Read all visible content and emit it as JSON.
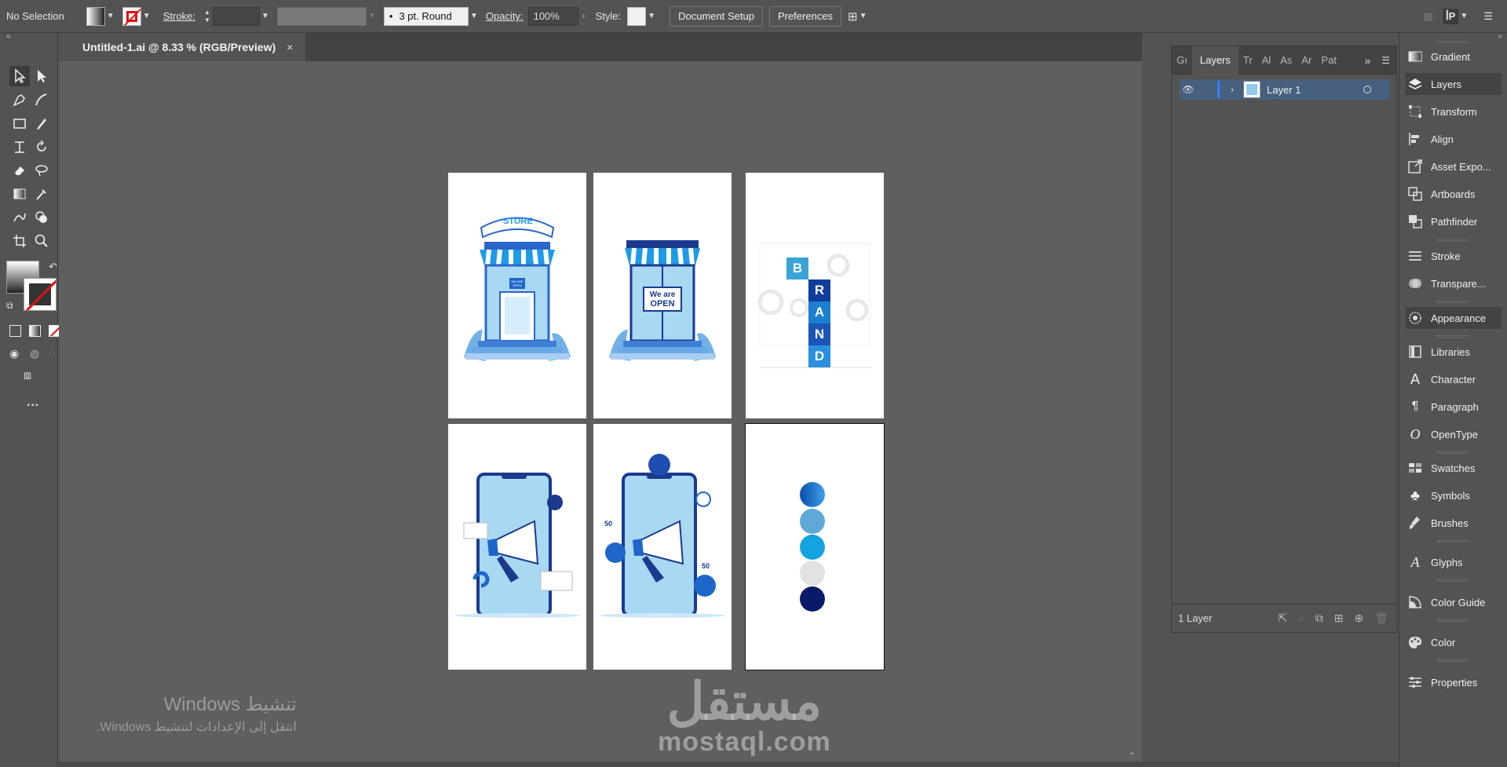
{
  "control_bar": {
    "selection": "No Selection",
    "stroke_label": "Stroke:",
    "stroke_weight": "",
    "brush": "3 pt. Round",
    "opacity_label": "Opacity:",
    "opacity_value": "100%",
    "style_label": "Style:",
    "document_setup": "Document Setup",
    "preferences": "Preferences"
  },
  "document": {
    "tab_title": "Untitled-1.ai @ 8.33 % (RGB/Preview)",
    "close": "×"
  },
  "artboards": {
    "store_sign": "STORE",
    "store_door_sign": "WE ARE OPEN",
    "open_sign_line1": "We are",
    "open_sign_line2": "OPEN",
    "brand_letters": [
      "B",
      "R",
      "A",
      "N",
      "D"
    ],
    "social_counts": [
      "50",
      "50"
    ],
    "palette": [
      "#0a4fa8",
      "#5fa8d8",
      "#12a3e0",
      "#e2e2e2",
      "#0a1a6b"
    ]
  },
  "layers_panel": {
    "tabs": [
      "Gı",
      "Layers",
      "Tr",
      "Al",
      "As",
      "Ar",
      "Pat"
    ],
    "layer_name": "Layer 1",
    "footer_count": "1 Layer"
  },
  "dock": {
    "items": [
      "Gradient",
      "Layers",
      "Transform",
      "Align",
      "Asset Expo...",
      "Artboards",
      "Pathfinder",
      "Stroke",
      "Transpare...",
      "Appearance",
      "Libraries",
      "Character",
      "Paragraph",
      "OpenType",
      "Swatches",
      "Symbols",
      "Brushes",
      "Glyphs",
      "Color Guide",
      "Color",
      "Properties"
    ]
  },
  "watermarks": {
    "windows_title": "تنشيط Windows",
    "windows_sub": "انتقل إلى الإعدادات لتنشيط Windows.",
    "mostaql_ar": "مستقل",
    "mostaql_en": "mostaql.com"
  }
}
